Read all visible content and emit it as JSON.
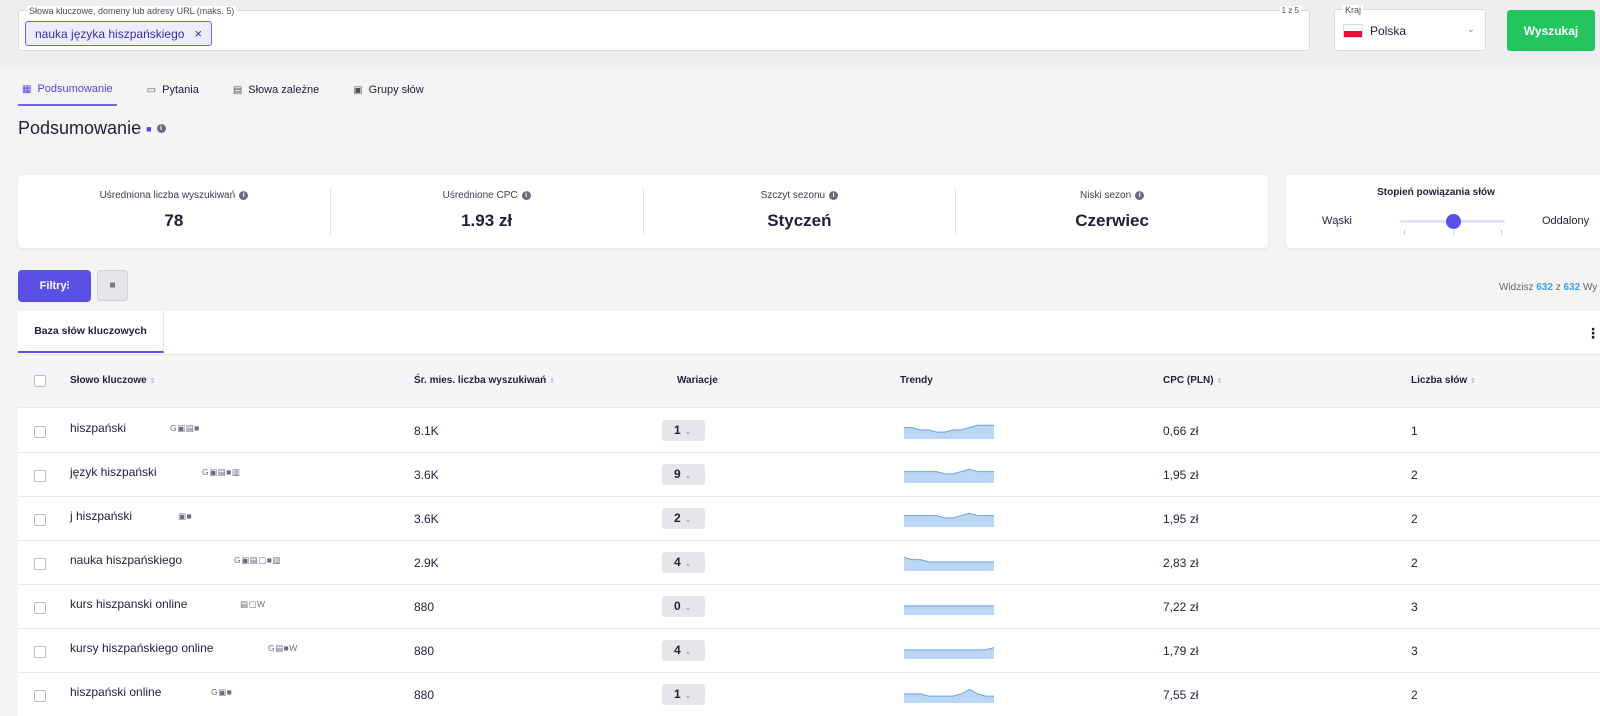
{
  "search": {
    "keyword_label": "Słowa kluczowe, domeny lub adresy URL (maks. 5)",
    "count_label": "1 z 5",
    "chip": "nauka języka hiszpańskiego",
    "chip_remove": "×",
    "country_label": "Kraj",
    "country_value": "Polska",
    "button_label": "Wyszukaj"
  },
  "tabs": [
    {
      "label": "Podsumowanie",
      "icon": "grid-icon",
      "active": true
    },
    {
      "label": "Pytania",
      "icon": "question-bubble-icon",
      "active": false
    },
    {
      "label": "Słowa zależne",
      "icon": "document-icon",
      "active": false
    },
    {
      "label": "Grupy słów",
      "icon": "group-icon",
      "active": false
    }
  ],
  "page_title": "Podsumowanie",
  "stats": [
    {
      "label": "Uśredniona liczba wyszukiwań",
      "value": "78"
    },
    {
      "label": "Uśrednione CPC",
      "value": "1.93 zł"
    },
    {
      "label": "Szczyt sezonu",
      "value": "Styczeń"
    },
    {
      "label": "Niski sezon",
      "value": "Czerwiec"
    }
  ],
  "relation": {
    "title": "Stopień powiązania słów",
    "left": "Wąski",
    "right": "Oddalony",
    "level": 0.5
  },
  "filters": {
    "filter_label": "Filtry",
    "summary_prefix": "Widzisz",
    "shown": "632",
    "summary_mid": "z",
    "total": "632",
    "summary_suffix": "Wy"
  },
  "table": {
    "tab_label": "Baza słów kluczowych",
    "columns": [
      "Słowo kluczowe",
      "Śr. mies. liczba wyszukiwań",
      "Wariacje",
      "Trendy",
      "CPC (PLN)",
      "Liczba słów"
    ],
    "rows": [
      {
        "keyword": "hiszpański",
        "serp": "G▣▤■",
        "volume": "8.1K",
        "variations": "1",
        "cpc": "0,66 zł",
        "words": "1",
        "trend": [
          5,
          5,
          4,
          4,
          3,
          3,
          4,
          4,
          5,
          6,
          6,
          6
        ]
      },
      {
        "keyword": "język hiszpański",
        "serp": "G▣▤■▥",
        "volume": "3.6K",
        "variations": "9",
        "cpc": "1,95 zł",
        "words": "2",
        "trend": [
          5,
          5,
          5,
          5,
          5,
          4,
          4,
          5,
          6,
          5,
          5,
          5
        ]
      },
      {
        "keyword": "j hiszpański",
        "serp": "▣■",
        "volume": "3.6K",
        "variations": "2",
        "cpc": "1,95 zł",
        "words": "2",
        "trend": [
          5,
          5,
          5,
          5,
          5,
          4,
          4,
          5,
          6,
          5,
          5,
          5
        ]
      },
      {
        "keyword": "nauka hiszpańskiego",
        "serp": "G▣▤▢■▥",
        "volume": "2.9K",
        "variations": "4",
        "cpc": "2,83 zł",
        "words": "2",
        "trend": [
          6,
          5,
          5,
          4,
          4,
          4,
          4,
          4,
          4,
          4,
          4,
          4
        ]
      },
      {
        "keyword": "kurs hiszpanski online",
        "serp": "▤▢W",
        "volume": "880",
        "variations": "0",
        "cpc": "7,22 zł",
        "words": "3",
        "trend": [
          4,
          4,
          4,
          4,
          4,
          4,
          4,
          4,
          4,
          4,
          4,
          4
        ]
      },
      {
        "keyword": "kursy hiszpańskiego online",
        "serp": "G▤■W",
        "volume": "880",
        "variations": "4",
        "cpc": "1,79 zł",
        "words": "3",
        "trend": [
          4,
          4,
          4,
          4,
          4,
          4,
          4,
          4,
          4,
          4,
          4,
          5
        ]
      },
      {
        "keyword": "hiszpański online",
        "serp": "G▣■",
        "volume": "880",
        "variations": "1",
        "cpc": "7,55 zł",
        "words": "2",
        "trend": [
          4,
          4,
          4,
          3,
          3,
          3,
          3,
          4,
          6,
          4,
          3,
          3
        ]
      }
    ]
  }
}
